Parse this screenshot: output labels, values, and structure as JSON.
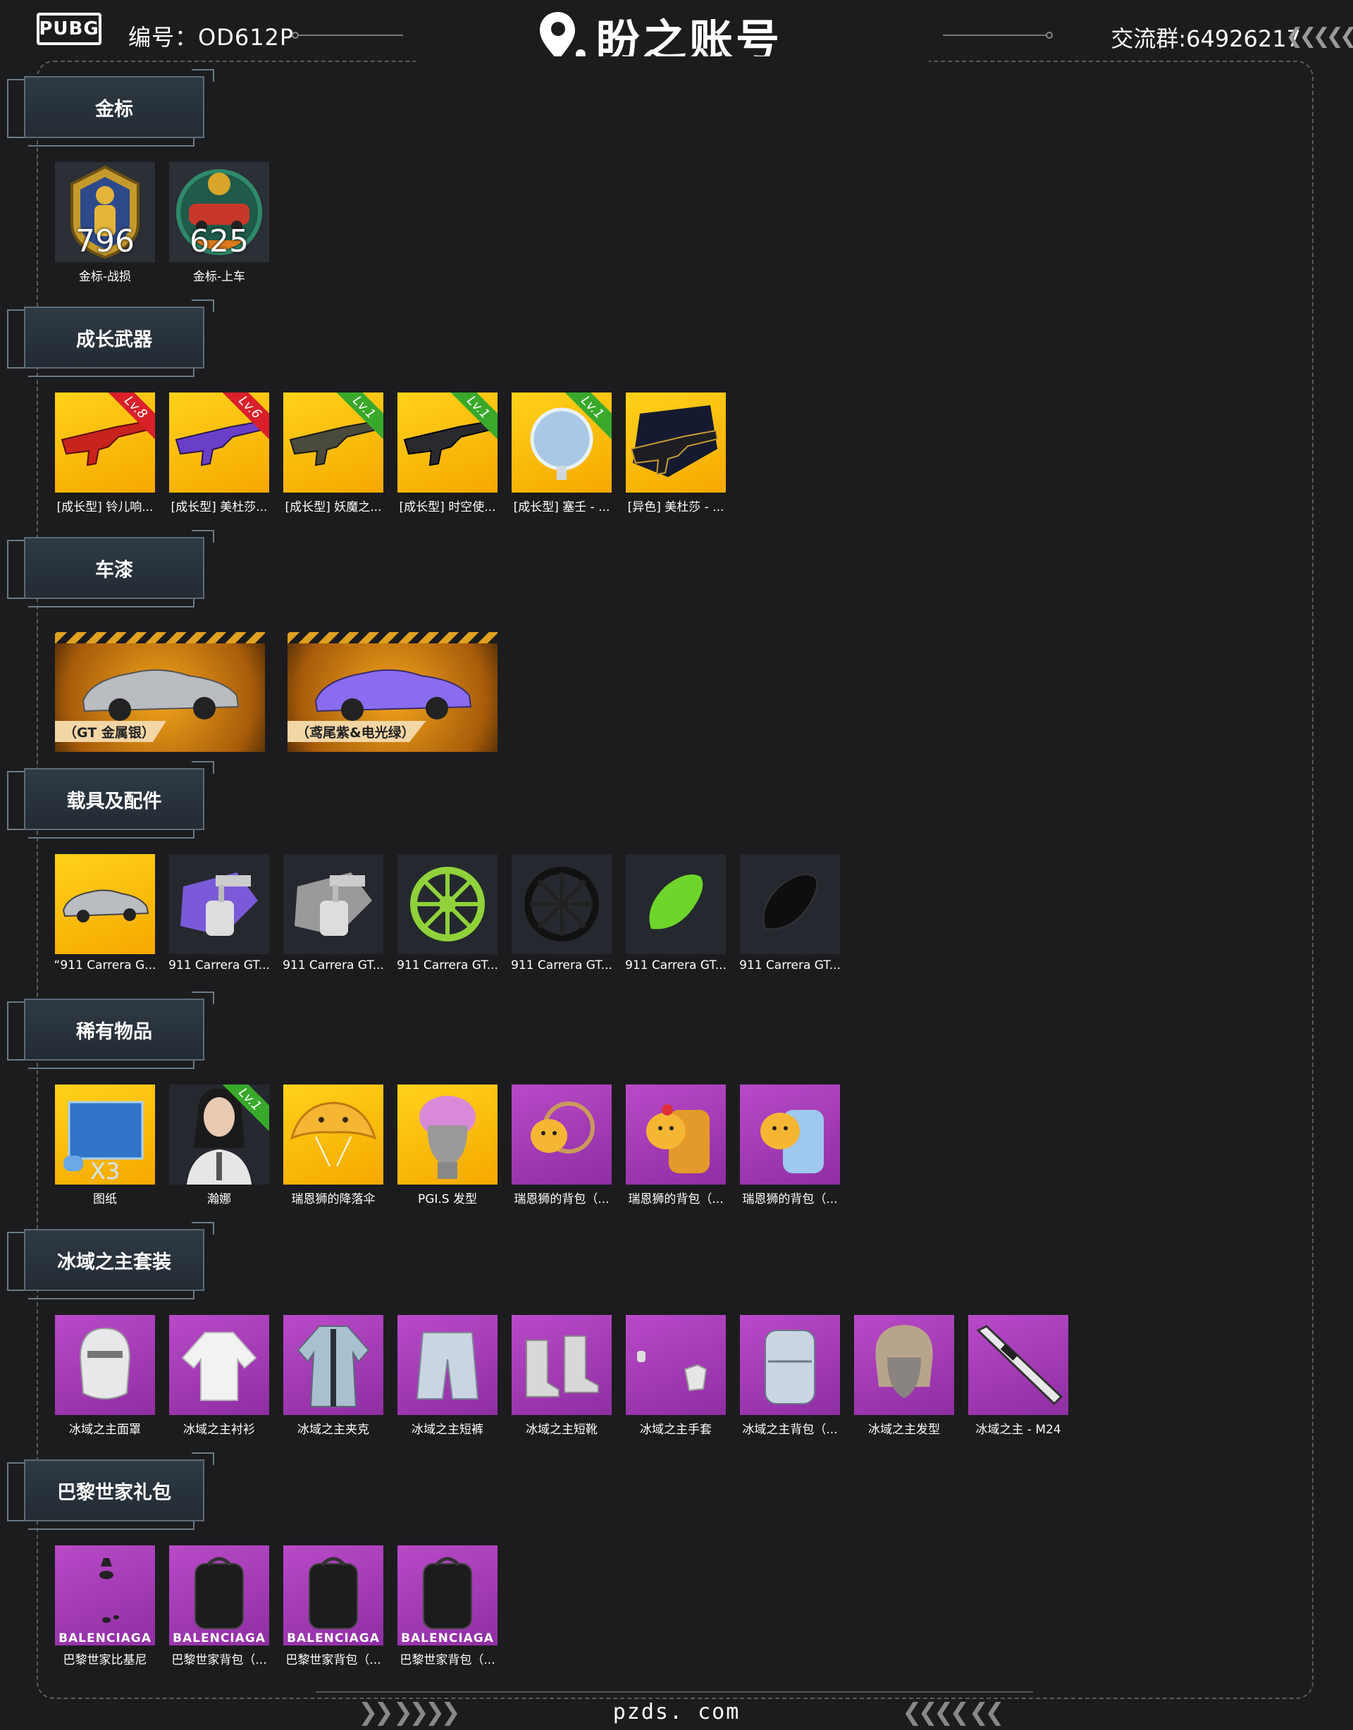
{
  "header": {
    "game_logo": "PUBG",
    "account_label": "编号：OD612P",
    "brand": "盼之账号",
    "group_label": "交流群:64926217"
  },
  "sections": [
    {
      "title": "金标",
      "items": [
        {
          "caption": "金标-战损",
          "badge": "796",
          "tile": "medal"
        },
        {
          "caption": "金标-上车",
          "badge": "625",
          "tile": "medal"
        }
      ]
    },
    {
      "title": "成长武器",
      "items": [
        {
          "caption": "[成长型] 铃儿响...",
          "level": "Lv.8",
          "level_color": "red",
          "tile": "gold"
        },
        {
          "caption": "[成长型] 美杜莎...",
          "level": "Lv.6",
          "level_color": "red",
          "tile": "gold"
        },
        {
          "caption": "[成长型] 妖魔之...",
          "level": "Lv.1",
          "level_color": "green",
          "tile": "gold"
        },
        {
          "caption": "[成长型] 时空使...",
          "level": "Lv.1",
          "level_color": "green",
          "tile": "gold"
        },
        {
          "caption": "[成长型] 塞壬 - ...",
          "level": "Lv.1",
          "level_color": "green",
          "tile": "gold"
        },
        {
          "caption": "[异色] 美杜莎 - ...",
          "tile": "gold"
        }
      ]
    },
    {
      "title": "车漆",
      "paints": [
        {
          "label": "（GT 金属银）",
          "car_color": "#b9bcc0"
        },
        {
          "label": "（鸢尾紫&电光绿）",
          "car_color": "#8a6cf0"
        }
      ]
    },
    {
      "title": "载具及配件",
      "items": [
        {
          "caption": "“911 Carrera G...",
          "tile": "gold"
        },
        {
          "caption": "911 Carrera GT...",
          "tile": "dark"
        },
        {
          "caption": "911 Carrera GT...",
          "tile": "dark"
        },
        {
          "caption": "911 Carrera GT...",
          "tile": "dark"
        },
        {
          "caption": "911 Carrera GT...",
          "tile": "dark"
        },
        {
          "caption": "911 Carrera GT...",
          "tile": "dark"
        },
        {
          "caption": "911 Carrera GT...",
          "tile": "dark"
        }
      ]
    },
    {
      "title": "稀有物品",
      "items": [
        {
          "caption": "图纸",
          "badge": "X3",
          "tile": "gold"
        },
        {
          "caption": "瀚娜",
          "level": "Lv.1",
          "level_color": "green",
          "tile": "dark"
        },
        {
          "caption": "瑞恩狮的降落伞",
          "tile": "gold"
        },
        {
          "caption": "PGI.S 发型",
          "tile": "gold"
        },
        {
          "caption": "瑞恩狮的背包（...",
          "tile": "purple"
        },
        {
          "caption": "瑞恩狮的背包（...",
          "tile": "purple"
        },
        {
          "caption": "瑞恩狮的背包（...",
          "tile": "purple"
        }
      ]
    },
    {
      "title": "冰域之主套装",
      "items": [
        {
          "caption": "冰域之主面罩",
          "tile": "purple"
        },
        {
          "caption": "冰域之主衬衫",
          "tile": "purple"
        },
        {
          "caption": "冰域之主夹克",
          "tile": "purple"
        },
        {
          "caption": "冰域之主短裤",
          "tile": "purple"
        },
        {
          "caption": "冰域之主短靴",
          "tile": "purple"
        },
        {
          "caption": "冰域之主手套",
          "tile": "purple"
        },
        {
          "caption": "冰域之主背包（...",
          "tile": "purple"
        },
        {
          "caption": "冰域之主发型",
          "tile": "purple"
        },
        {
          "caption": "冰域之主 - M24",
          "tile": "purple"
        }
      ]
    },
    {
      "title": "巴黎世家礼包",
      "items": [
        {
          "caption": "巴黎世家比基尼",
          "badge": "BALENCIAGA",
          "tile": "purple"
        },
        {
          "caption": "巴黎世家背包（...",
          "badge": "BALENCIAGA",
          "tile": "purple"
        },
        {
          "caption": "巴黎世家背包（...",
          "badge": "BALENCIAGA",
          "tile": "purple"
        },
        {
          "caption": "巴黎世家背包（...",
          "badge": "BALENCIAGA",
          "tile": "purple"
        }
      ]
    }
  ],
  "footer": {
    "site": "pzds. com"
  }
}
